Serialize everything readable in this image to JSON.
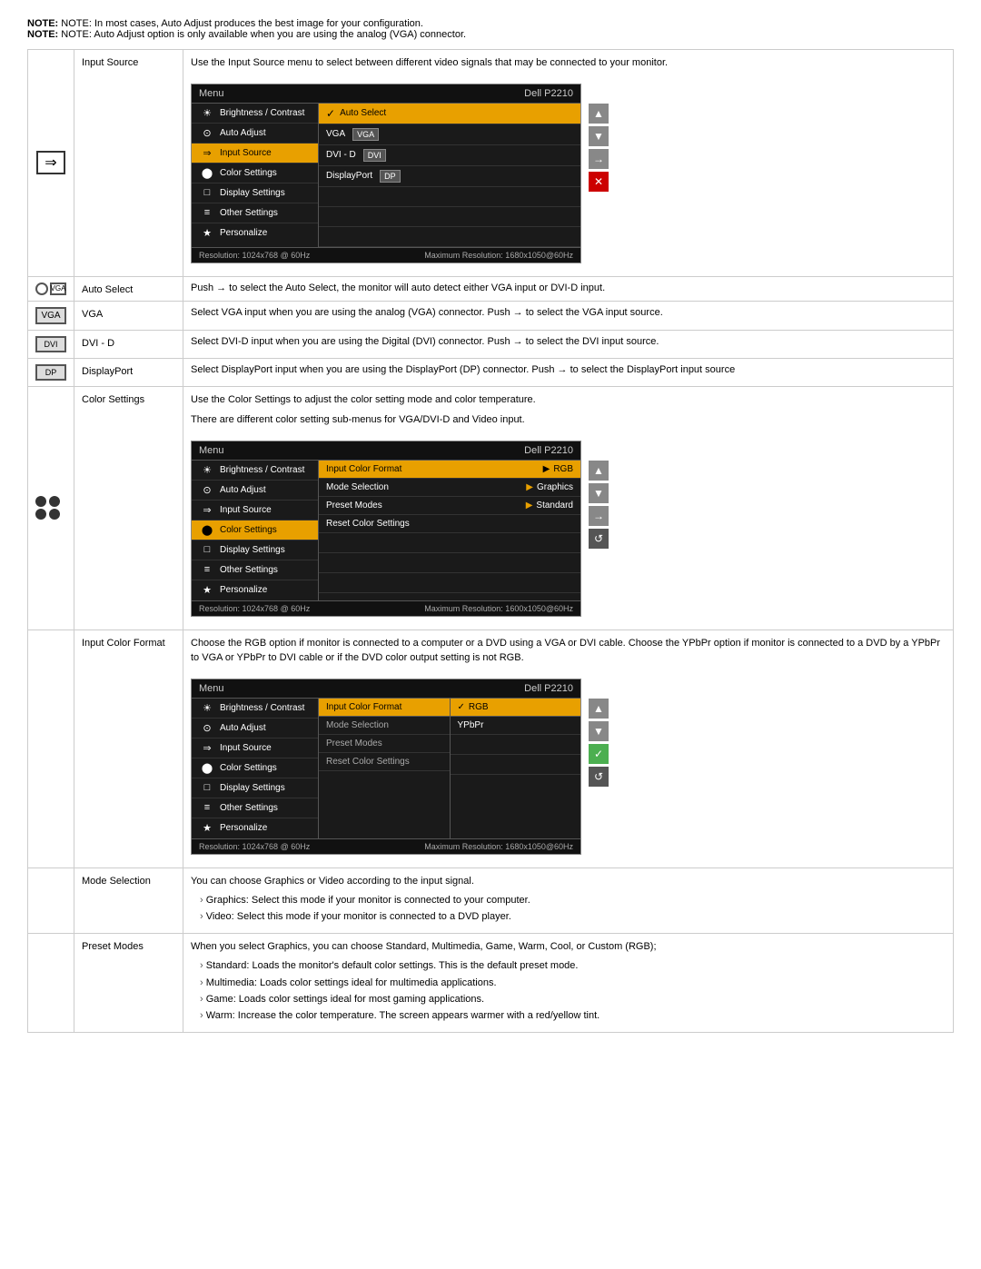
{
  "notes": [
    "NOTE: In most cases, Auto Adjust produces the best image for your configuration.",
    "NOTE: Auto Adjust option is only available when you are using the analog (VGA) connector."
  ],
  "brand": "Dell P2210",
  "menu_label": "Menu",
  "osd_footer_left": "Resolution: 1024x768 @ 60Hz",
  "osd_footer_right": "Maximum Resolution: 1680x1050@60Hz",
  "osd_footer_right2": "Maximum Resolution: 1600x1050@60Hz",
  "sections": [
    {
      "id": "input-source",
      "label": "Input Source",
      "description": "Use the Input Source menu to select between different video signals that may be connected to your monitor.",
      "osd_menu": {
        "left_items": [
          {
            "icon": "☀",
            "text": "Brightness / Contrast",
            "active": false
          },
          {
            "icon": "⊙",
            "text": "Auto Adjust",
            "active": false
          },
          {
            "icon": "⇒",
            "text": "Input Source",
            "active": true
          },
          {
            "icon": "••",
            "text": "Color Settings",
            "active": false
          },
          {
            "icon": "□",
            "text": "Display Settings",
            "active": false
          },
          {
            "icon": "≡",
            "text": "Other Settings",
            "active": false
          },
          {
            "icon": "★",
            "text": "Personalize",
            "active": false
          }
        ],
        "right_items": [
          {
            "text": "Auto Select",
            "selected": true,
            "icon": "✓",
            "connector": ""
          },
          {
            "text": "VGA",
            "selected": false,
            "icon": "",
            "connector": "VGA"
          },
          {
            "text": "DVI - D",
            "selected": false,
            "icon": "",
            "connector": "DVI"
          },
          {
            "text": "DisplayPort",
            "selected": false,
            "icon": "",
            "connector": "DP"
          }
        ],
        "nav": [
          "▲",
          "▼",
          "→",
          "✕"
        ]
      }
    },
    {
      "id": "auto-select",
      "label": "Auto Select",
      "description": "Push → to select the Auto Select, the monitor will auto detect either VGA input or DVI-D input."
    },
    {
      "id": "vga",
      "label": "VGA",
      "description": "Select VGA input when you are using the analog (VGA) connector. Push → to select the VGA input source."
    },
    {
      "id": "dvi-d",
      "label": "DVI - D",
      "description": "Select DVI-D input when you are using the Digital (DVI) connector. Push → to select the DVI input source."
    },
    {
      "id": "displayport",
      "label": "DisplayPort",
      "description": "Select DisplayPort input when you are using the DisplayPort (DP) connector. Push → to select the DisplayPort input source"
    },
    {
      "id": "color-settings",
      "label": "Color Settings",
      "description1": "Use the Color Settings to adjust the color setting mode and color temperature.",
      "description2": "There are different color setting sub-menus for VGA/DVI-D and Video input.",
      "osd_menu": {
        "left_items": [
          {
            "icon": "☀",
            "text": "Brightness / Contrast",
            "active": false
          },
          {
            "icon": "⊙",
            "text": "Auto Adjust",
            "active": false
          },
          {
            "icon": "⇒",
            "text": "Input Source",
            "active": false
          },
          {
            "icon": "••",
            "text": "Color Settings",
            "active": true
          },
          {
            "icon": "□",
            "text": "Display Settings",
            "active": false
          },
          {
            "icon": "≡",
            "text": "Other Settings",
            "active": false
          },
          {
            "icon": "★",
            "text": "Personalize",
            "active": false
          }
        ],
        "right_items": [
          {
            "text": "Input Color Format",
            "highlighted": true,
            "arrow": "▶",
            "value": "RGB"
          },
          {
            "text": "Mode Selection",
            "highlighted": false,
            "arrow": "▶",
            "value": "Graphics"
          },
          {
            "text": "Preset Modes",
            "highlighted": false,
            "arrow": "▶",
            "value": "Standard"
          },
          {
            "text": "Reset Color Settings",
            "highlighted": false,
            "arrow": "",
            "value": ""
          }
        ],
        "nav": [
          "▲",
          "▼",
          "→",
          "↺"
        ]
      }
    },
    {
      "id": "input-color-format",
      "label": "Input Color Format",
      "description": "Choose the RGB option if monitor is connected to a computer or a DVD using a VGA or DVI cable. Choose the YPbPr option if monitor is connected to a DVD by a YPbPr to VGA or YPbPr to DVI cable or if the DVD color output setting is not RGB.",
      "osd_menu": {
        "left_items": [
          {
            "icon": "☀",
            "text": "Brightness / Contrast",
            "active": false
          },
          {
            "icon": "⊙",
            "text": "Auto Adjust",
            "active": false
          },
          {
            "icon": "⇒",
            "text": "Input Source",
            "active": false
          },
          {
            "icon": "••",
            "text": "Color Settings",
            "active": false
          },
          {
            "icon": "□",
            "text": "Display Settings",
            "active": false
          },
          {
            "icon": "≡",
            "text": "Other Settings",
            "active": false
          },
          {
            "icon": "★",
            "text": "Personalize",
            "active": false
          }
        ],
        "right_col1": "Input Color Format",
        "right_items2": [
          {
            "text": "✓ RGB",
            "highlighted": true
          },
          {
            "text": "YPbPr",
            "highlighted": false
          },
          {
            "text": "Preset Modes",
            "highlighted": false,
            "empty": true
          },
          {
            "text": "Reset Color Settings",
            "highlighted": false,
            "empty": true
          }
        ],
        "nav": [
          "▲",
          "▼",
          "✓",
          "↺"
        ]
      }
    },
    {
      "id": "mode-selection",
      "label": "Mode Selection",
      "description": "You can choose Graphics or Video according to the input signal.",
      "sub_items": [
        "Graphics: Select this mode if your monitor is connected to your computer.",
        "Video: Select this mode if your monitor is connected to a DVD player."
      ]
    },
    {
      "id": "preset-modes",
      "label": "Preset Modes",
      "description": "When you select Graphics, you can choose Standard, Multimedia, Game, Warm, Cool, or Custom (RGB);",
      "sub_items": [
        "Standard: Loads the monitor's default color settings. This is the default preset mode.",
        "Multimedia: Loads color settings ideal for multimedia applications.",
        "Game: Loads color settings ideal for most gaming applications.",
        "Warm: Increase the color temperature. The screen appears warmer with a red/yellow tint."
      ]
    }
  ]
}
